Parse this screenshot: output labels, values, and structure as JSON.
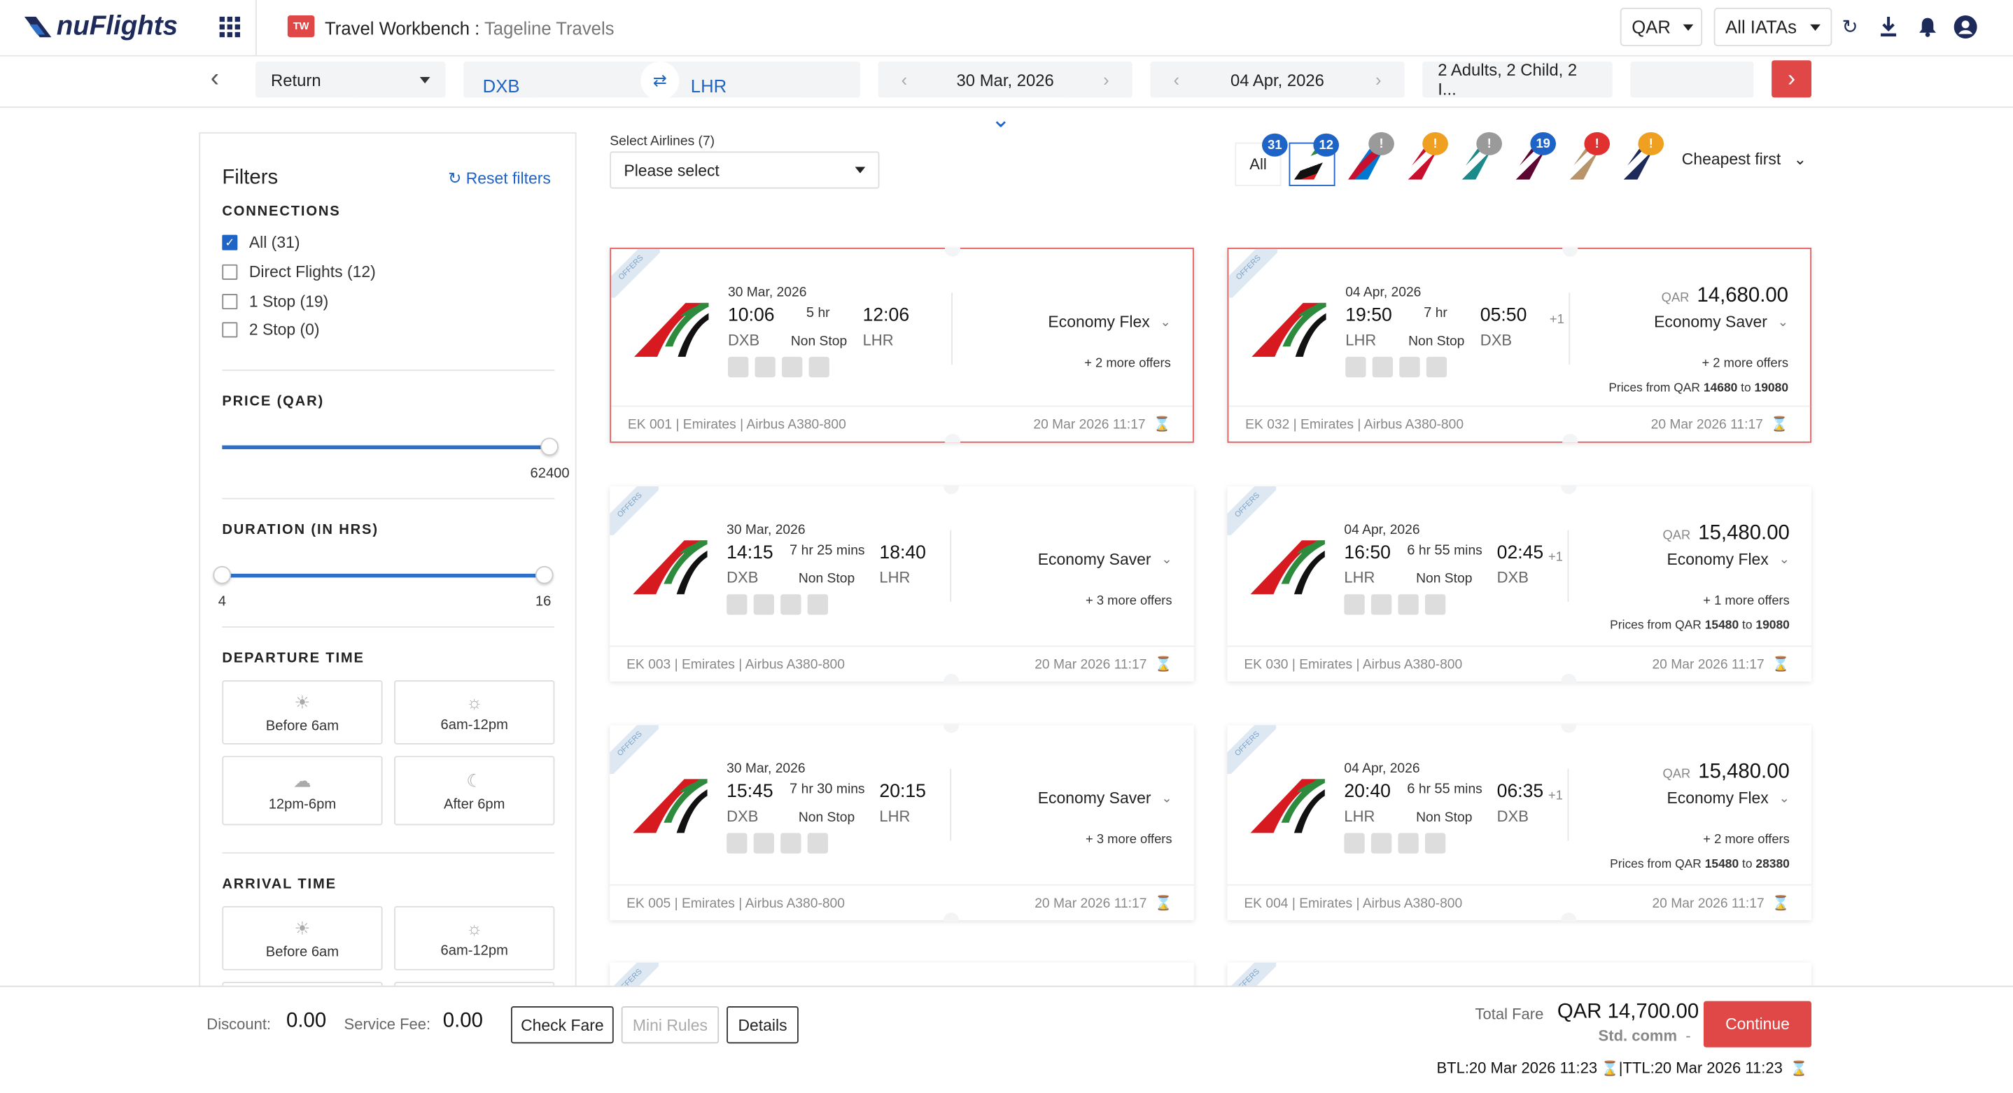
{
  "app": {
    "brand": "nuFlights",
    "workbench_title": "Travel Workbench :",
    "workbench_sub": "Tageline Travels",
    "workbench_icon": "TW"
  },
  "header": {
    "currency": "QAR",
    "iata": "All IATAs"
  },
  "search": {
    "trip_type": "Return",
    "from": "DXB",
    "to": "LHR",
    "depart": "30 Mar, 2026",
    "return": "04 Apr, 2026",
    "pax": "2 Adults, 2 Child, 2 I..."
  },
  "filters": {
    "title": "Filters",
    "reset": "Reset filters",
    "connections_title": "CONNECTIONS",
    "connections": [
      {
        "label": "All (31)",
        "checked": true
      },
      {
        "label": "Direct Flights (12)",
        "checked": false
      },
      {
        "label": "1 Stop (19)",
        "checked": false
      },
      {
        "label": "2 Stop (0)",
        "checked": false
      }
    ],
    "price_title": "PRICE (QAR)",
    "price_max": "62400",
    "duration_title": "DURATION (IN HRS)",
    "duration_min": "4",
    "duration_max": "16",
    "departure_title": "DEPARTURE TIME",
    "arrival_title": "ARRIVAL TIME",
    "time_slots": [
      "Before 6am",
      "6am-12pm",
      "12pm-6pm",
      "After 6pm"
    ]
  },
  "results": {
    "select_airlines_label": "Select Airlines (7)",
    "select_placeholder": "Please select",
    "all_tab": "All",
    "all_count": "31",
    "sort": "Cheapest first",
    "airline_tabs": [
      {
        "badge": "12",
        "badge_color": "#1e63c6",
        "icon": "emirates-tail-icon"
      },
      {
        "badge": "!",
        "badge_color": "#9a9a9a",
        "icon": "american-tail-icon"
      },
      {
        "badge": "!",
        "badge_color": "#f0a020",
        "icon": "turkish-tail-icon"
      },
      {
        "badge": "!",
        "badge_color": "#9a9a9a",
        "icon": "oman-tail-icon"
      },
      {
        "badge": "19",
        "badge_color": "#1e63c6",
        "icon": "qatar-tail-icon"
      },
      {
        "badge": "!",
        "badge_color": "#e03030",
        "icon": "etihad-tail-icon"
      },
      {
        "badge": "!",
        "badge_color": "#f0a020",
        "icon": "singapore-tail-icon"
      }
    ],
    "ribbon": "OFFERS",
    "outbound": [
      {
        "date": "30 Mar, 2026",
        "dep": "10:06",
        "arr": "12:06",
        "dur_h": "5",
        "dur_m": "",
        "from": "DXB",
        "to": "LHR",
        "stops": "Non Stop",
        "class": "Economy Flex",
        "more": "+ 2 more offers",
        "flight": "EK 001 | Emirates | Airbus A380-800",
        "stamp": "20 Mar 2026 11:17"
      },
      {
        "date": "30 Mar, 2026",
        "dep": "14:15",
        "arr": "18:40",
        "dur_h": "7",
        "dur_m": "25",
        "from": "DXB",
        "to": "LHR",
        "stops": "Non Stop",
        "class": "Economy Saver",
        "more": "+ 3 more offers",
        "flight": "EK 003 | Emirates | Airbus A380-800",
        "stamp": "20 Mar 2026 11:17"
      },
      {
        "date": "30 Mar, 2026",
        "dep": "15:45",
        "arr": "20:15",
        "dur_h": "7",
        "dur_m": "30",
        "from": "DXB",
        "to": "LHR",
        "stops": "Non Stop",
        "class": "Economy Saver",
        "more": "+ 3 more offers",
        "flight": "EK 005 | Emirates | Airbus A380-800",
        "stamp": "20 Mar 2026 11:17"
      }
    ],
    "inbound": [
      {
        "date": "04 Apr, 2026",
        "dep": "19:50",
        "arr": "05:50",
        "plus": "+1",
        "dur_h": "7",
        "dur_m": "",
        "from": "LHR",
        "to": "DXB",
        "stops": "Non Stop",
        "cur": "QAR",
        "price": "14,680.00",
        "class": "Economy Saver",
        "more": "+ 2 more offers",
        "range_pre": "Prices from QAR ",
        "range_lo": "14680",
        "range_mid": " to ",
        "range_hi": "19080",
        "flight": "EK 032 | Emirates | Airbus A380-800",
        "stamp": "20 Mar 2026 11:17"
      },
      {
        "date": "04 Apr, 2026",
        "dep": "16:50",
        "arr": "02:45",
        "plus": "+1",
        "dur_h": "6",
        "dur_m": "55",
        "from": "LHR",
        "to": "DXB",
        "stops": "Non Stop",
        "cur": "QAR",
        "price": "15,480.00",
        "class": "Economy Flex",
        "more": "+ 1 more offers",
        "range_pre": "Prices from QAR ",
        "range_lo": "15480",
        "range_mid": " to ",
        "range_hi": "19080",
        "flight": "EK 030 | Emirates | Airbus A380-800",
        "stamp": "20 Mar 2026 11:17"
      },
      {
        "date": "04 Apr, 2026",
        "dep": "20:40",
        "arr": "06:35",
        "plus": "+1",
        "dur_h": "6",
        "dur_m": "55",
        "from": "LHR",
        "to": "DXB",
        "stops": "Non Stop",
        "cur": "QAR",
        "price": "15,480.00",
        "class": "Economy Flex",
        "more": "+ 2 more offers",
        "range_pre": "Prices from QAR ",
        "range_lo": "15480",
        "range_mid": " to ",
        "range_hi": "28380",
        "flight": "EK 004 | Emirates | Airbus A380-800",
        "stamp": "20 Mar 2026 11:17"
      }
    ]
  },
  "footer": {
    "discount_label": "Discount:",
    "discount": "0.00",
    "service_label": "Service Fee:",
    "service": "0.00",
    "check_fare": "Check Fare",
    "mini_rules": "Mini Rules",
    "details": "Details",
    "total_label": "Total Fare",
    "total": "QAR 14,700.00",
    "std_label": "Std. comm",
    "std_value": "-",
    "continue": "Continue",
    "btl": "BTL:20 Mar 2026 11:23",
    "ttl": "|TTL:20 Mar 2026 11:23"
  }
}
